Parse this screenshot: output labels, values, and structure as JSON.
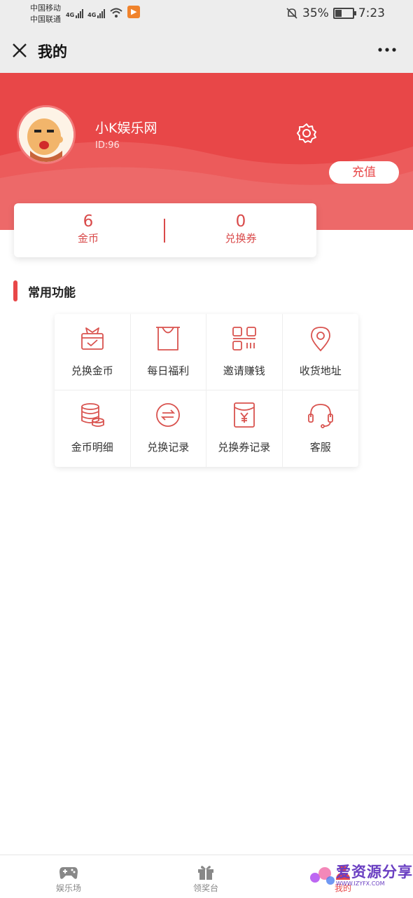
{
  "status_bar": {
    "carrier_1": "中国移动",
    "carrier_2": "中国联通",
    "net_1": "4G",
    "net_2": "4G",
    "battery": "35%",
    "time": "7:23"
  },
  "titlebar": {
    "title": "我的"
  },
  "profile": {
    "name": "小K娱乐网",
    "id": "ID:96",
    "recharge_label": "充值"
  },
  "balance": {
    "coin_value": "6",
    "coin_label": "金币",
    "voucher_value": "0",
    "voucher_label": "兑换券"
  },
  "section": {
    "title": "常用功能"
  },
  "functions": [
    {
      "label": "兑换金币",
      "icon": "gift-box-icon"
    },
    {
      "label": "每日福利",
      "icon": "bag-icon"
    },
    {
      "label": "邀请赚钱",
      "icon": "qr-code-icon"
    },
    {
      "label": "收货地址",
      "icon": "location-pin-icon"
    },
    {
      "label": "金币明细",
      "icon": "coin-stack-icon"
    },
    {
      "label": "兑换记录",
      "icon": "exchange-icon"
    },
    {
      "label": "兑换券记录",
      "icon": "yen-envelope-icon"
    },
    {
      "label": "客服",
      "icon": "headset-icon"
    }
  ],
  "bottom_nav": [
    {
      "label": "娱乐场",
      "icon": "gamepad-icon",
      "active": false
    },
    {
      "label": "领奖台",
      "icon": "gift-icon",
      "active": false
    },
    {
      "label": "我的",
      "icon": "user-icon",
      "active": true
    }
  ],
  "watermark": {
    "text": "爱资源分享",
    "sub": "WWW.IZYFX.COM"
  },
  "colors": {
    "accent": "#e84748",
    "icon": "#d9534f"
  }
}
